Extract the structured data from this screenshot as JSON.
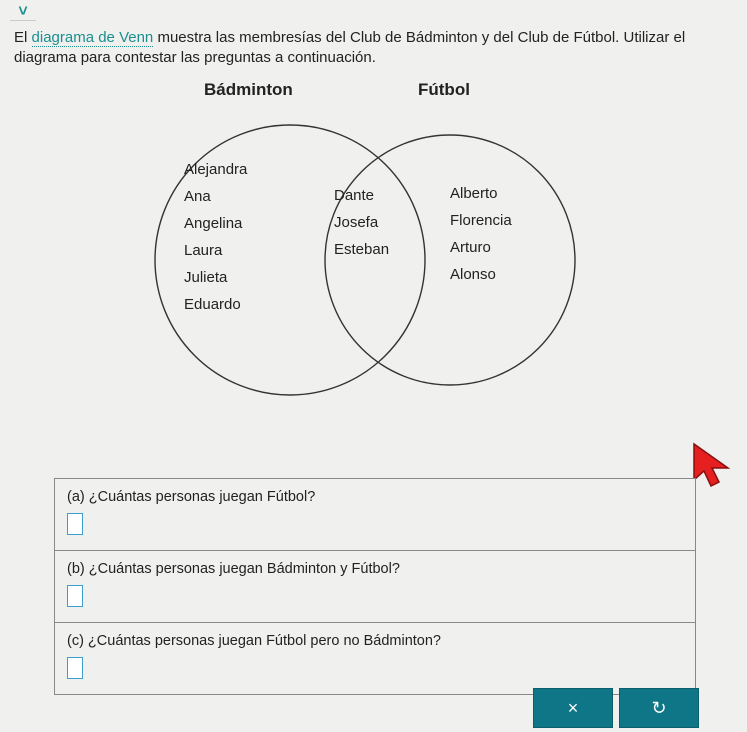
{
  "intro_prefix": "El ",
  "intro_link": "diagrama de Venn",
  "intro_rest": " muestra las membresías del Club de Bádminton y del Club de Fútbol. Utilizar el diagrama para contestar las preguntas a continuación.",
  "labels": {
    "left": "Bádminton",
    "right": "Fútbol"
  },
  "venn": {
    "left_only": [
      "Alejandra",
      "Ana",
      "Angelina",
      "Laura",
      "Julieta",
      "Eduardo"
    ],
    "intersection": [
      "Dante",
      "Josefa",
      "Esteban"
    ],
    "right_only": [
      "Alberto",
      "Florencia",
      "Arturo",
      "Alonso"
    ]
  },
  "questions": {
    "a": "(a) ¿Cuántas personas juegan Fútbol?",
    "b": "(b) ¿Cuántas personas juegan Bádminton y Fútbol?",
    "c": "(c) ¿Cuántas personas juegan Fútbol pero no Bádminton?"
  },
  "buttons": {
    "close": "×",
    "reset": "↻"
  },
  "chart_data": {
    "type": "venn",
    "sets": [
      {
        "name": "Bádminton",
        "only": [
          "Alejandra",
          "Ana",
          "Angelina",
          "Laura",
          "Julieta",
          "Eduardo"
        ]
      },
      {
        "name": "Fútbol",
        "only": [
          "Alberto",
          "Florencia",
          "Arturo",
          "Alonso"
        ]
      }
    ],
    "intersection": [
      "Dante",
      "Josefa",
      "Esteban"
    ]
  }
}
